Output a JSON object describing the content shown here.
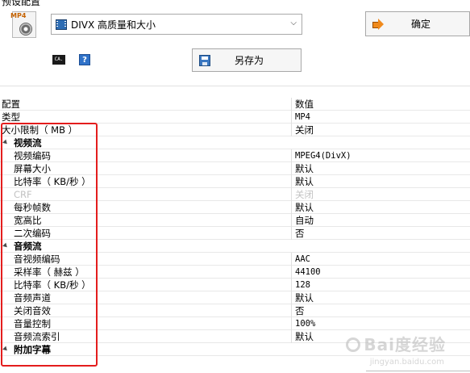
{
  "header": {
    "preset_label": "预设配置",
    "preset_value": "DIVX 高质量和大小",
    "ok_label": "确定",
    "saveas_label": "另存为",
    "cmd_icon_text": "CA.",
    "help_icon_text": "?",
    "file_icon_text": "MP4"
  },
  "grid": {
    "col_name": "配置",
    "col_value": "数值",
    "rows": [
      {
        "name": "类型",
        "value": "MP4"
      },
      {
        "name": "大小限制（ MB ）",
        "value": "关闭"
      },
      {
        "group": "视频流"
      },
      {
        "name": "视频编码",
        "value": "MPEG4(DivX)"
      },
      {
        "name": "屏幕大小",
        "value": "默认"
      },
      {
        "name": "比特率（ KB/秒 ）",
        "value": "默认"
      },
      {
        "name": "CRF",
        "value": "关闭",
        "disabled": true
      },
      {
        "name": "每秒帧数",
        "value": "默认"
      },
      {
        "name": "宽高比",
        "value": "自动"
      },
      {
        "name": "二次编码",
        "value": "否"
      },
      {
        "group": "音频流"
      },
      {
        "name": "音视频编码",
        "value": "AAC"
      },
      {
        "name": "采样率（ 赫兹 ）",
        "value": "44100"
      },
      {
        "name": "比特率（ KB/秒 ）",
        "value": "128"
      },
      {
        "name": "音频声道",
        "value": "默认"
      },
      {
        "name": "关闭音效",
        "value": "否"
      },
      {
        "name": "音量控制",
        "value": "100%"
      },
      {
        "name": "音频流索引",
        "value": "默认"
      },
      {
        "group": "附加字幕"
      }
    ]
  },
  "watermark": {
    "text": "Bai度经验",
    "sub": "jingyan.baidu.com"
  },
  "colors": {
    "highlight": "#e41d1d",
    "accent": "#f08a1c"
  }
}
